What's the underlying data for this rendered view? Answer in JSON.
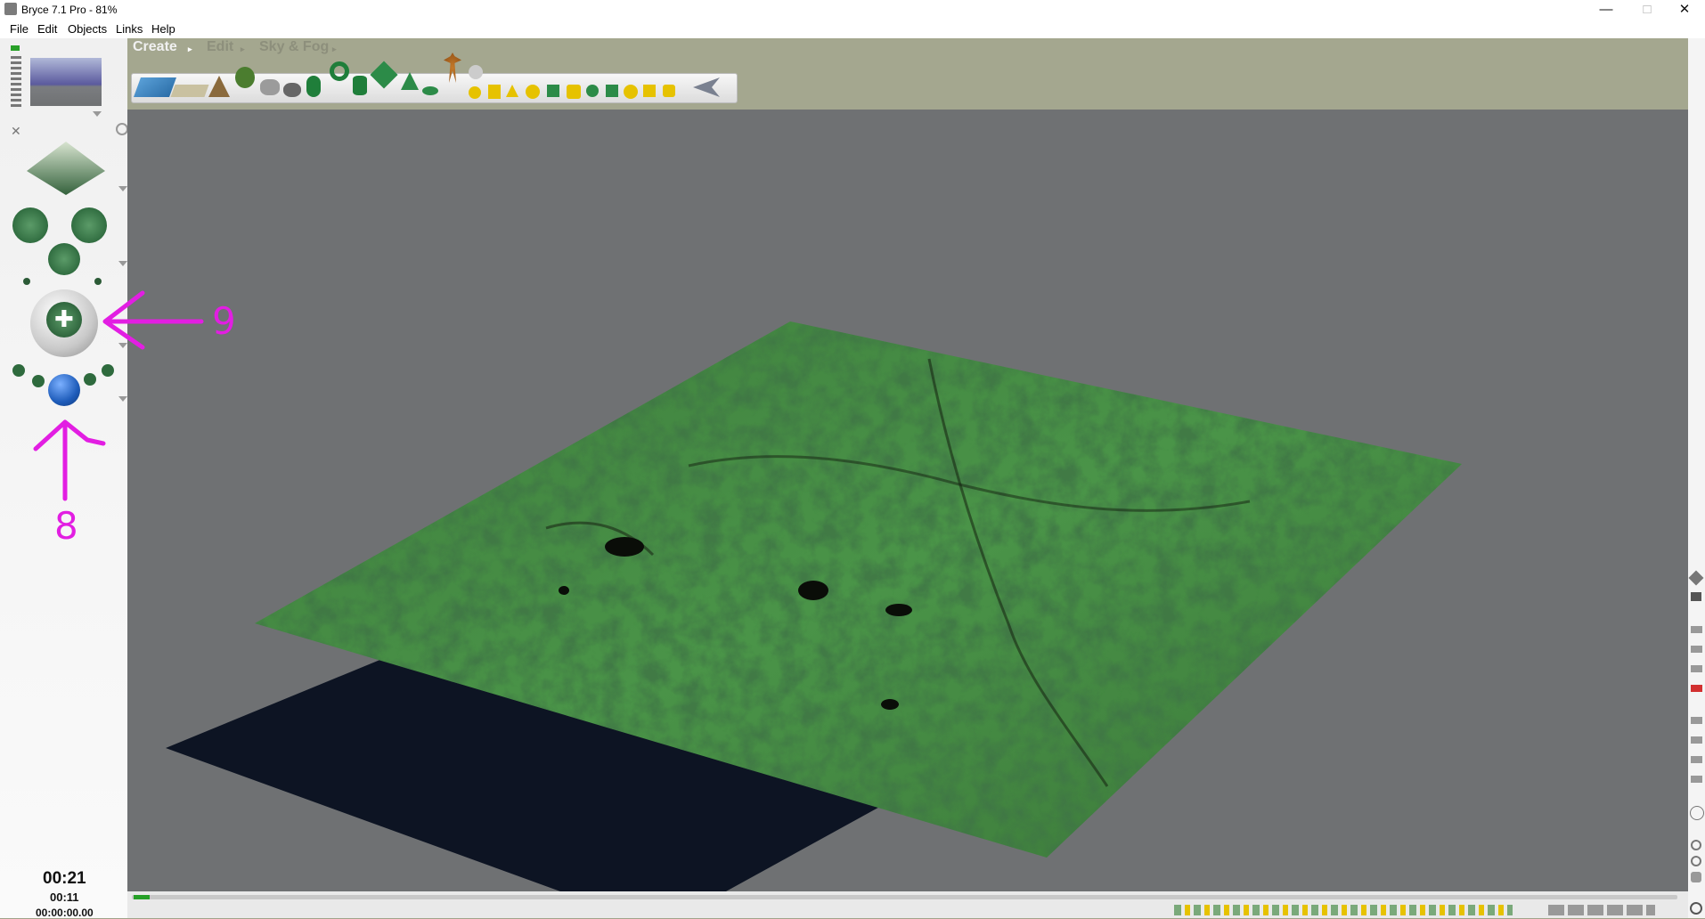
{
  "window": {
    "title": "Bryce 7.1  Pro - 81%",
    "controls": {
      "minimize": "—",
      "maximize": "□",
      "close": "✕"
    }
  },
  "menubar": {
    "items": [
      "File",
      "Edit",
      "Objects",
      "Links",
      "Help"
    ]
  },
  "tabs": [
    {
      "label": "Create",
      "active": true
    },
    {
      "label": "Edit",
      "active": false
    },
    {
      "label": "Sky & Fog",
      "active": false
    }
  ],
  "toolbar": {
    "icons": [
      "water-plane-icon",
      "ground-plane-icon",
      "terrain-icon",
      "tree-icon",
      "rock-icon",
      "stone-icon",
      "cone-plant-icon",
      "torus-icon",
      "cylinder-icon",
      "cube-icon",
      "pyramid-icon",
      "disc-icon",
      "human-figure-icon",
      "sphere-light-icon",
      "spotlight-icon",
      "parallel-light-icon",
      "square-light-icon",
      "sun-light-icon",
      "radial-light-icon",
      "cube-light-icon",
      "misc-light-icon",
      "camera-icon"
    ]
  },
  "time": {
    "current": "00:21",
    "elapsed": "00:11",
    "frames": "00:00:00.00"
  },
  "annotations": [
    {
      "label": "9"
    },
    {
      "label": "8"
    }
  ],
  "colors": {
    "accent": "#e21ee2",
    "viewport": "#6f7173",
    "terrain": "#3e7a3a",
    "shadow": "#0d1423"
  }
}
